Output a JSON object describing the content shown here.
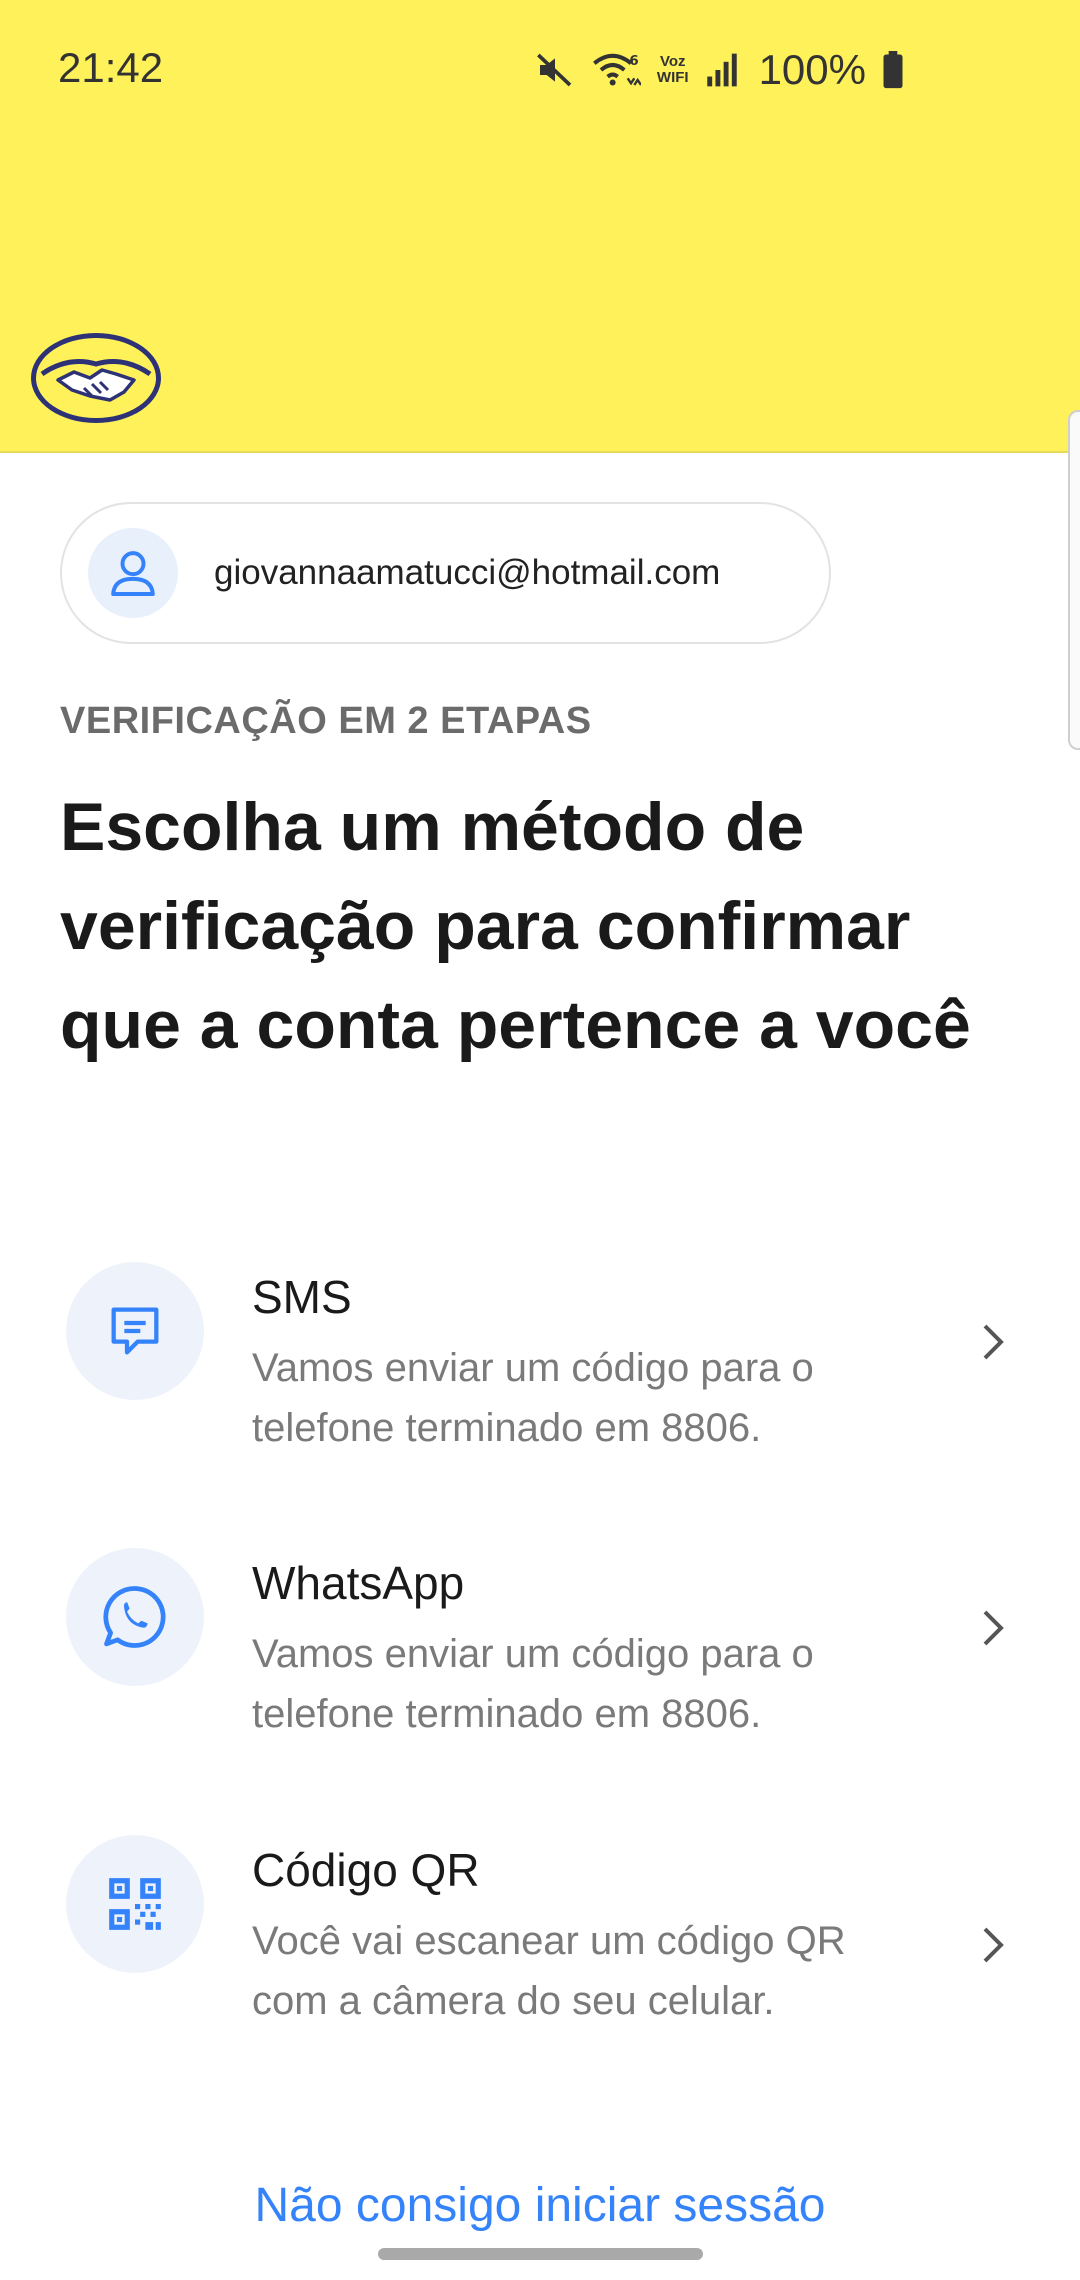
{
  "status_bar": {
    "time": "21:42",
    "battery": "100%",
    "icons": [
      "mute-icon",
      "wifi-6-icon",
      "voz-wifi-icon",
      "signal-icon",
      "battery-icon"
    ],
    "voz_line1": "Voz",
    "voz_line2": "WIFI"
  },
  "brand": {
    "logo": "mercado-handshake-logo",
    "header_color": "#fff159",
    "accent_color": "#3483fa"
  },
  "account": {
    "email": "giovannaamatucci@hotmail.com",
    "icon": "user-icon"
  },
  "verification": {
    "eyebrow": "VERIFICAÇÃO EM 2 ETAPAS",
    "title": "Escolha um método de verificação para confirmar que a conta pertence a você"
  },
  "options": [
    {
      "title": "SMS",
      "desc": "Vamos enviar um código para o telefone terminado em 8806.",
      "icon": "message-icon"
    },
    {
      "title": "WhatsApp",
      "desc": "Vamos enviar um código para o telefone terminado em 8806.",
      "icon": "whatsapp-icon"
    },
    {
      "title": "Código QR",
      "desc": "Você vai escanear um código QR com a câmera do seu celular.",
      "icon": "qr-code-icon"
    }
  ],
  "footer": {
    "cant_login": "Não consigo iniciar sessão"
  }
}
